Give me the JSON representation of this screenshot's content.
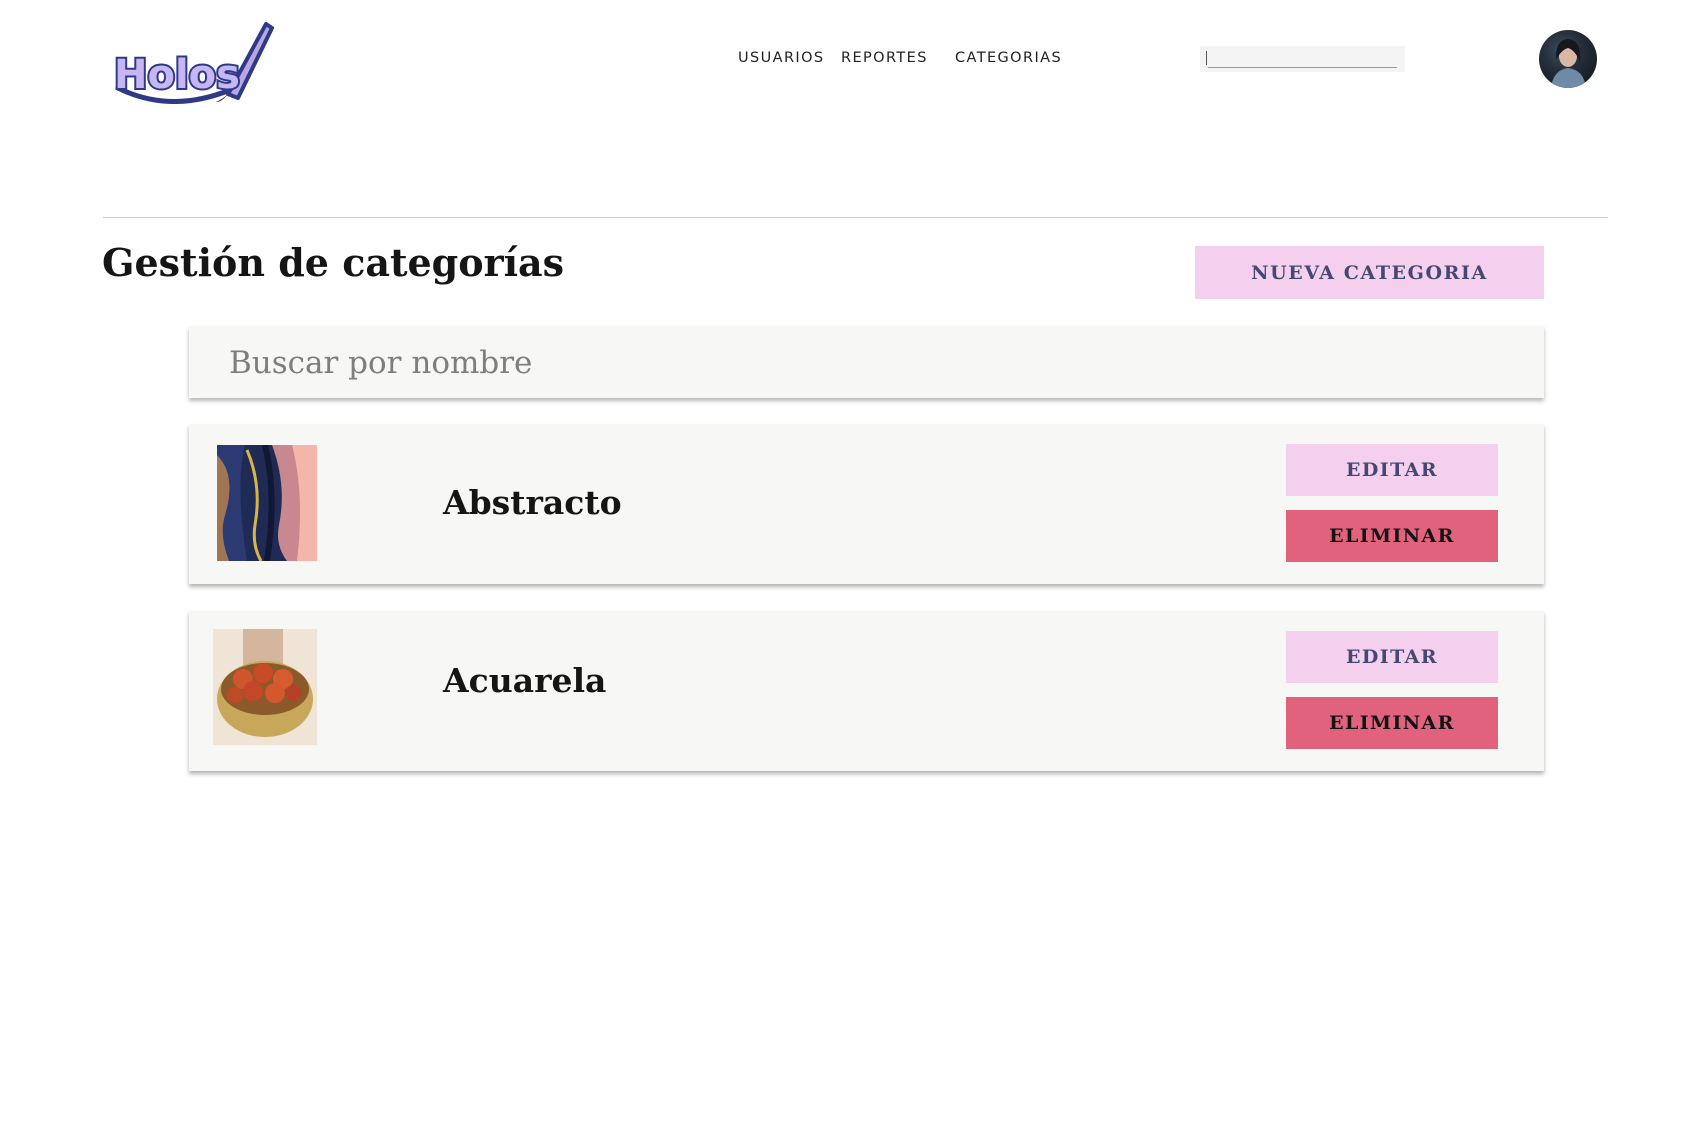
{
  "header": {
    "logo_text": "Holos",
    "nav": [
      {
        "label": "USUARIOS"
      },
      {
        "label": "REPORTES"
      },
      {
        "label": "CATEGORIAS"
      }
    ],
    "search": {
      "value": ""
    }
  },
  "main": {
    "title": "Gestión de categorías",
    "new_button_label": "NUEVA CATEGORIA",
    "search": {
      "placeholder": "Buscar por nombre",
      "value": ""
    },
    "categories": [
      {
        "name": "Abstracto",
        "edit_label": "EDITAR",
        "delete_label": "ELIMINAR"
      },
      {
        "name": "Acuarela",
        "edit_label": "EDITAR",
        "delete_label": "ELIMINAR"
      }
    ]
  },
  "colors": {
    "accent_pink": "#f4d0ee",
    "delete_red": "#e0627c",
    "button_text": "#454870",
    "card_bg": "#f7f7f5"
  }
}
